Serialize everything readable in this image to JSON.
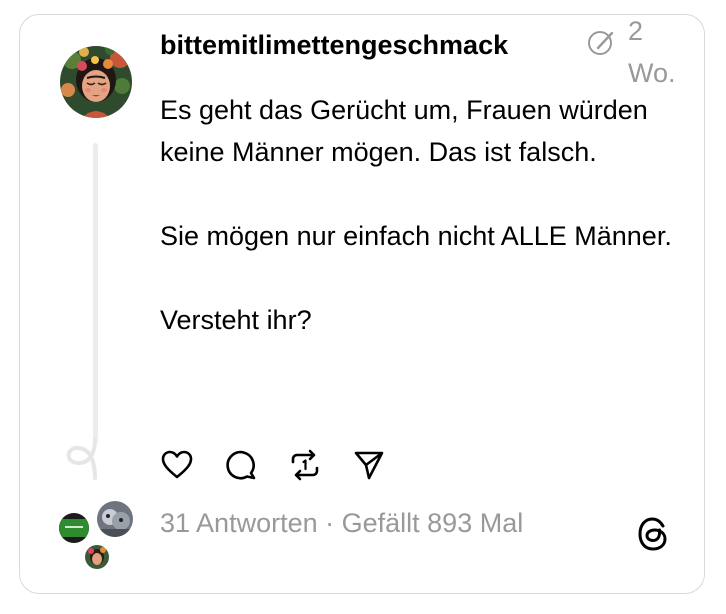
{
  "post": {
    "username": "bittemitlimettengeschmack",
    "time_line1": "2",
    "time_line2": "Wo.",
    "paragraph1": "Es geht das Gerücht um, Frauen würden keine Männer mögen. Das ist falsch.",
    "paragraph2": "Sie mögen nur einfach nicht ALLE Männer.",
    "paragraph3": "Versteht ihr?"
  },
  "footer": {
    "replies": "31 Antworten",
    "separator": " · ",
    "likes": "Gefällt 893 Mal"
  },
  "colors": {
    "text": "#000000",
    "muted": "#999999",
    "border": "#d9d9d9",
    "thread_line": "#ececec"
  },
  "icons": [
    "edit-icon",
    "heart-icon",
    "comment-icon",
    "repost-icon",
    "share-icon",
    "threads-logo-icon"
  ]
}
